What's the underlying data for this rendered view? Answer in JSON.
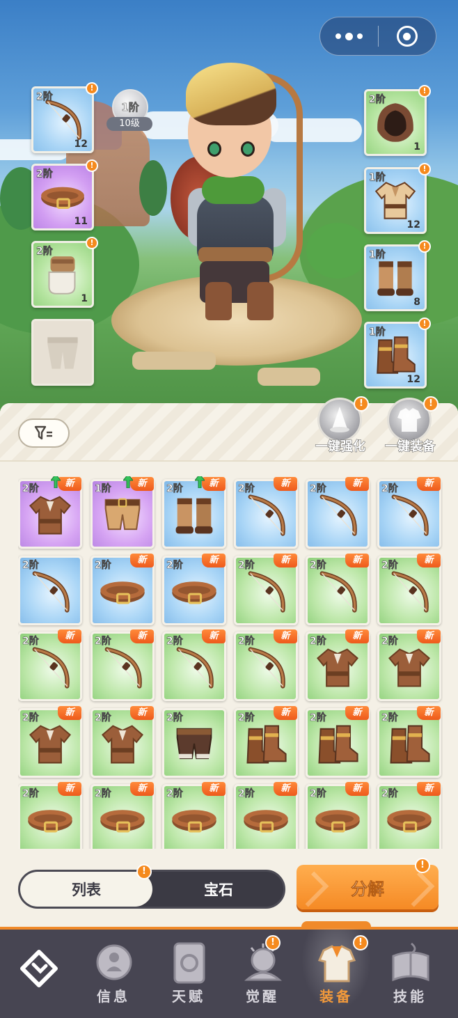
{
  "capsule": {
    "more_icon": "more-dots-icon",
    "close_icon": "target-close-icon"
  },
  "hero_level": {
    "tier": "1阶",
    "level": "10级"
  },
  "equipped_left": [
    {
      "tier": "2阶",
      "count": "12",
      "rarity": "blue",
      "item": "bow",
      "alert": "!"
    },
    {
      "tier": "2阶",
      "count": "11",
      "rarity": "purple",
      "item": "belt",
      "alert": "!"
    },
    {
      "tier": "2阶",
      "count": "1",
      "rarity": "green",
      "item": "gloves",
      "alert": "!"
    },
    {
      "tier": "",
      "count": "",
      "rarity": "empty",
      "item": "pants-placeholder",
      "alert": ""
    }
  ],
  "equipped_right": [
    {
      "tier": "2阶",
      "count": "1",
      "rarity": "green",
      "item": "hood",
      "alert": "!"
    },
    {
      "tier": "1阶",
      "count": "12",
      "rarity": "blue",
      "item": "shirt",
      "alert": "!"
    },
    {
      "tier": "1阶",
      "count": "8",
      "rarity": "blue",
      "item": "greaves",
      "alert": "!"
    },
    {
      "tier": "1阶",
      "count": "12",
      "rarity": "blue",
      "item": "boots",
      "alert": "!"
    }
  ],
  "toolbar": {
    "filter_icon": "filter-icon",
    "enhance_all": "一键强化",
    "equip_all": "一键装备",
    "alert": "!"
  },
  "inventory": [
    {
      "tier": "2阶",
      "rarity": "purple",
      "item": "jacket",
      "new": "新",
      "upgrade": true
    },
    {
      "tier": "1阶",
      "rarity": "purple",
      "item": "shorts",
      "new": "新",
      "upgrade": true
    },
    {
      "tier": "2阶",
      "rarity": "blue",
      "item": "greaves",
      "new": "新",
      "upgrade": true
    },
    {
      "tier": "2阶",
      "rarity": "blue",
      "item": "bow",
      "new": "新",
      "upgrade": false
    },
    {
      "tier": "2阶",
      "rarity": "blue",
      "item": "bow",
      "new": "新",
      "upgrade": false
    },
    {
      "tier": "2阶",
      "rarity": "blue",
      "item": "bow",
      "new": "新",
      "upgrade": false
    },
    {
      "tier": "2阶",
      "rarity": "blue",
      "item": "bow",
      "new": "",
      "upgrade": false
    },
    {
      "tier": "2阶",
      "rarity": "blue",
      "item": "belt",
      "new": "新",
      "upgrade": false
    },
    {
      "tier": "2阶",
      "rarity": "blue",
      "item": "belt",
      "new": "新",
      "upgrade": false
    },
    {
      "tier": "2阶",
      "rarity": "green",
      "item": "bow",
      "new": "新",
      "upgrade": false
    },
    {
      "tier": "2阶",
      "rarity": "green",
      "item": "bow",
      "new": "新",
      "upgrade": false
    },
    {
      "tier": "2阶",
      "rarity": "green",
      "item": "bow",
      "new": "新",
      "upgrade": false
    },
    {
      "tier": "2阶",
      "rarity": "green",
      "item": "bow",
      "new": "新",
      "upgrade": false
    },
    {
      "tier": "2阶",
      "rarity": "green",
      "item": "bow",
      "new": "新",
      "upgrade": false
    },
    {
      "tier": "2阶",
      "rarity": "green",
      "item": "bow",
      "new": "新",
      "upgrade": false
    },
    {
      "tier": "2阶",
      "rarity": "green",
      "item": "bow",
      "new": "新",
      "upgrade": false
    },
    {
      "tier": "2阶",
      "rarity": "green",
      "item": "jacket",
      "new": "新",
      "upgrade": false
    },
    {
      "tier": "2阶",
      "rarity": "green",
      "item": "jacket",
      "new": "新",
      "upgrade": false
    },
    {
      "tier": "2阶",
      "rarity": "green",
      "item": "jacket",
      "new": "新",
      "upgrade": false
    },
    {
      "tier": "2阶",
      "rarity": "green",
      "item": "jacket",
      "new": "新",
      "upgrade": false
    },
    {
      "tier": "2阶",
      "rarity": "green",
      "item": "shorts-dark",
      "new": "",
      "upgrade": false
    },
    {
      "tier": "2阶",
      "rarity": "green",
      "item": "boots",
      "new": "新",
      "upgrade": false
    },
    {
      "tier": "2阶",
      "rarity": "green",
      "item": "boots",
      "new": "新",
      "upgrade": false
    },
    {
      "tier": "2阶",
      "rarity": "green",
      "item": "boots",
      "new": "新",
      "upgrade": false
    },
    {
      "tier": "2阶",
      "rarity": "green",
      "item": "belt",
      "new": "新",
      "upgrade": false
    },
    {
      "tier": "2阶",
      "rarity": "green",
      "item": "belt",
      "new": "新",
      "upgrade": false
    },
    {
      "tier": "2阶",
      "rarity": "green",
      "item": "belt",
      "new": "新",
      "upgrade": false
    },
    {
      "tier": "2阶",
      "rarity": "green",
      "item": "belt",
      "new": "新",
      "upgrade": false
    },
    {
      "tier": "2阶",
      "rarity": "green",
      "item": "belt",
      "new": "新",
      "upgrade": false
    },
    {
      "tier": "2阶",
      "rarity": "green",
      "item": "belt",
      "new": "新",
      "upgrade": false
    }
  ],
  "view_toggle": {
    "list": "列表",
    "gems": "宝石",
    "alert": "!"
  },
  "decompose": {
    "label": "分解",
    "alert": "!"
  },
  "nav": {
    "logo_icon": "game-logo-icon",
    "items": [
      {
        "label": "信息",
        "icon": "info-icon",
        "active": false,
        "alert": ""
      },
      {
        "label": "天赋",
        "icon": "talent-icon",
        "active": false,
        "alert": ""
      },
      {
        "label": "觉醒",
        "icon": "awaken-icon",
        "active": false,
        "alert": "!"
      },
      {
        "label": "装备",
        "icon": "equipment-icon",
        "active": true,
        "alert": "!"
      },
      {
        "label": "技能",
        "icon": "skill-book-icon",
        "active": false,
        "alert": ""
      }
    ]
  }
}
